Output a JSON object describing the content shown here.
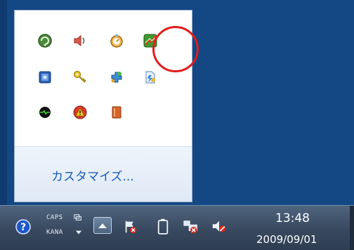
{
  "popup": {
    "customize_label": "カスタマイズ...",
    "icons": [
      {
        "icon": "green-refresh-icon"
      },
      {
        "icon": "speaker-volume-icon"
      },
      {
        "icon": "stopwatch-icon"
      },
      {
        "icon": "green-network-icon"
      },
      {
        "icon": "blue-book-icon"
      },
      {
        "icon": "yellow-key-icon"
      },
      {
        "icon": "puzzle-app-icon"
      },
      {
        "icon": "flash-file-icon"
      },
      {
        "icon": "black-oval-monitor-icon"
      },
      {
        "icon": "red-warning-app-icon"
      },
      {
        "icon": "orange-book-icon"
      }
    ],
    "highlight_color": "#e21b1b"
  },
  "taskbar": {
    "indicator_caps": "CAPS",
    "indicator_kana": "KANA",
    "clock_time": "13:48",
    "clock_date": "2009/09/01",
    "icons": [
      "help-icon",
      "show-hidden-icons-button",
      "action-center-flag-icon",
      "battery-icon",
      "network-disconnected-icon",
      "volume-muted-icon"
    ]
  },
  "colors": {
    "desktop": "#144884",
    "taskbar": "#3a4c63",
    "link": "#1a5bb8"
  }
}
